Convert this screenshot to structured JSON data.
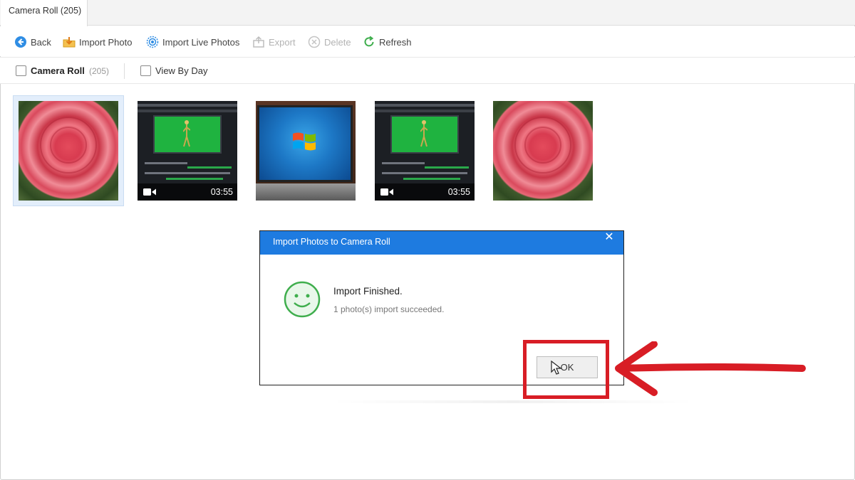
{
  "tab": {
    "label": "Camera Roll (205)"
  },
  "toolbar": {
    "back": "Back",
    "import_photo": "Import Photo",
    "import_live_photos": "Import Live Photos",
    "export": "Export",
    "delete": "Delete",
    "refresh": "Refresh"
  },
  "filters": {
    "camera_roll_label": "Camera Roll",
    "camera_roll_count": "(205)",
    "view_by_day_label": "View By Day"
  },
  "thumbnails": [
    {
      "kind": "photo",
      "subject": "rose"
    },
    {
      "kind": "video",
      "duration": "03:55"
    },
    {
      "kind": "photo",
      "subject": "laptop"
    },
    {
      "kind": "video",
      "duration": "03:55"
    },
    {
      "kind": "photo",
      "subject": "rose"
    }
  ],
  "dialog": {
    "title": "Import Photos to Camera Roll",
    "close_glyph": "✕",
    "heading": "Import Finished.",
    "message": "1 photo(s) import succeeded.",
    "ok_label": "OK"
  },
  "colors": {
    "dialog_title_bar": "#1e7be0",
    "annotation_red": "#d81d25",
    "success_green": "#3fae4d"
  }
}
